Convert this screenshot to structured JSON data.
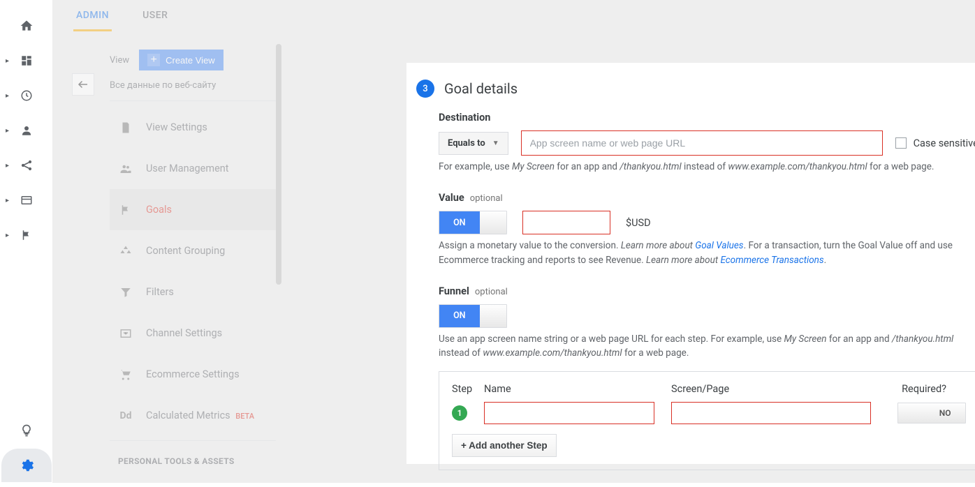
{
  "tabs": {
    "admin": "ADMIN",
    "user": "USER"
  },
  "view": {
    "label": "View",
    "create_btn": "Create View",
    "subtitle": "Все данные по веб-сайту",
    "menu": [
      "View Settings",
      "User Management",
      "Goals",
      "Content Grouping",
      "Filters",
      "Channel Settings",
      "Ecommerce Settings",
      "Calculated Metrics"
    ],
    "beta": "BETA",
    "section_head": "PERSONAL TOOLS & ASSETS"
  },
  "panel": {
    "step_num": "3",
    "title": "Goal details",
    "destination": {
      "label": "Destination",
      "match": "Equals to",
      "placeholder": "App screen name or web page URL",
      "case_sensitive": "Case sensitive",
      "hint_pre": "For example, use ",
      "hint_i1": "My Screen",
      "hint_mid": " for an app and ",
      "hint_i2": "/thankyou.html",
      "hint_mid2": " instead of ",
      "hint_i3": "www.example.com/thankyou.html",
      "hint_post": " for a web page."
    },
    "value": {
      "label": "Value",
      "optional": "optional",
      "toggle": "ON",
      "currency": "$USD",
      "hint1": "Assign a monetary value to the conversion. ",
      "hint1_i": "Learn more about ",
      "hint1_a": "Goal Values",
      "hint2": ". For a transaction, turn the Goal Value off and use Ecommerce tracking and reports to see Revenue. ",
      "hint2_i": "Learn more about ",
      "hint2_a": "Ecommerce Transactions",
      "hint_dot": "."
    },
    "funnel": {
      "label": "Funnel",
      "optional": "optional",
      "toggle": "ON",
      "hint_pre": "Use an app screen name string or a web page URL for each step. For example, use ",
      "hint_i1": "My Screen",
      "hint_mid": " for an app and ",
      "hint_i2": "/thankyou.html",
      "hint_mid2": " instead of ",
      "hint_i3": "www.example.com/thankyou.html",
      "hint_post": " for a web page.",
      "cols": {
        "step": "Step",
        "name": "Name",
        "page": "Screen/Page",
        "req": "Required?"
      },
      "step1": "1",
      "req_no": "NO",
      "add": "+ Add another Step"
    }
  }
}
